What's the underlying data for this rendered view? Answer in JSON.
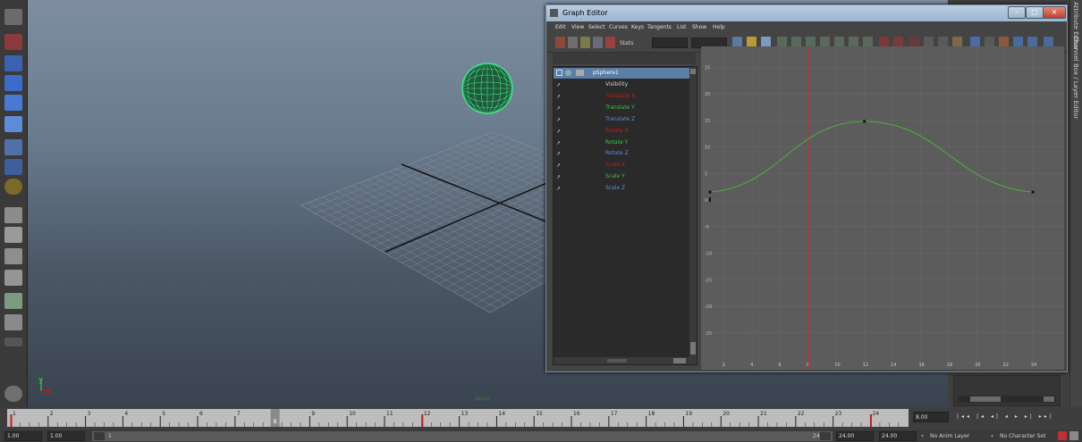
{
  "graph_editor": {
    "title": "Graph Editor",
    "menu": [
      "Edit",
      "View",
      "Select",
      "Curves",
      "Keys",
      "Tangents",
      "List",
      "Show",
      "Help"
    ],
    "stats_label": "Stats",
    "outliner": {
      "object": "pSphere1",
      "channels": [
        {
          "label": "Visibility",
          "color": "#cfcfcf"
        },
        {
          "label": "Translate X",
          "color": "#d01818"
        },
        {
          "label": "Translate Y",
          "color": "#3ec43e"
        },
        {
          "label": "Translate Z",
          "color": "#5b8de0"
        },
        {
          "label": "Rotate X",
          "color": "#d01818"
        },
        {
          "label": "Rotate Y",
          "color": "#3ec43e"
        },
        {
          "label": "Rotate Z",
          "color": "#5b8de0"
        },
        {
          "label": "Scale X",
          "color": "#d01818"
        },
        {
          "label": "Scale Y",
          "color": "#3ec43e"
        },
        {
          "label": "Scale Z",
          "color": "#5b8de0"
        }
      ]
    },
    "graph": {
      "x_ticks": [
        "2",
        "4",
        "6",
        "8",
        "10",
        "12",
        "14",
        "16",
        "18",
        "20",
        "22",
        "24"
      ],
      "y_ticks": [
        "25",
        "20",
        "15",
        "10",
        "5",
        "0",
        "-5",
        "-10",
        "-15",
        "-20",
        "-25"
      ],
      "current_frame_marker": "8",
      "curve_color": "#4caf3c",
      "current_time_color": "#d02828",
      "keys": [
        {
          "frame": 1,
          "value": 1.5
        },
        {
          "frame": 12,
          "value": 14.8
        },
        {
          "frame": 24,
          "value": 1.5
        }
      ]
    }
  },
  "right_tabs": {
    "tab1": "Channel Box / Layer Editor",
    "tab2": "Attribute Editor"
  },
  "viewport": {
    "axis_y": "y",
    "axis_x": "x",
    "camera_label": "persp"
  },
  "timeline": {
    "labels": [
      "1",
      "2",
      "3",
      "4",
      "5",
      "6",
      "7",
      "8",
      "9",
      "10",
      "11",
      "12",
      "13",
      "14",
      "15",
      "16",
      "17",
      "18",
      "19",
      "20",
      "21",
      "22",
      "23",
      "24"
    ],
    "current_frame_field": "8.00",
    "current_marker": "8"
  },
  "range": {
    "start_field": "1.00",
    "start_field2": "1.00",
    "slider_left_label": "1",
    "slider_right_label": "24",
    "end_field": "24.00",
    "end_field2": "24.00",
    "anim_layer": "No Anim Layer",
    "character_set": "No Character Set"
  }
}
